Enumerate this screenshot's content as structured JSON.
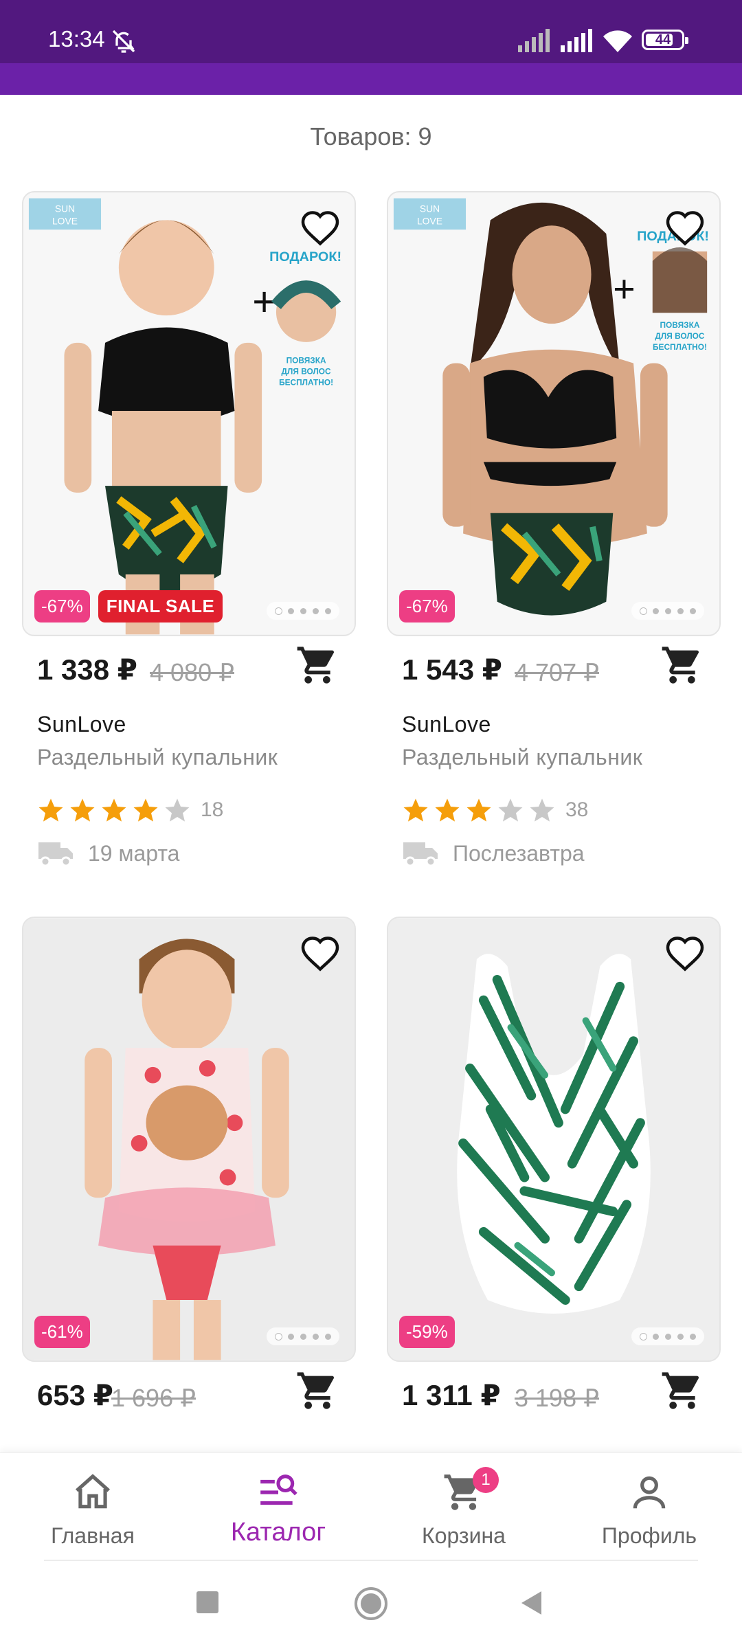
{
  "status_bar": {
    "time": "13:34",
    "battery": "44"
  },
  "catalog": {
    "count_label": "Товаров: 9"
  },
  "products": [
    {
      "price": "1 338 ₽",
      "old_price": "4 080 ₽",
      "brand": "SunLove",
      "type": "Раздельный купальник",
      "discount": "-67%",
      "sale_badge": "FINAL SALE",
      "rating": 4,
      "reviews": "18",
      "delivery": "19 марта"
    },
    {
      "price": "1 543 ₽",
      "old_price": "4 707 ₽",
      "brand": "SunLove",
      "type": "Раздельный купальник",
      "discount": "-67%",
      "rating": 3,
      "reviews": "38",
      "delivery": "Послезавтра"
    },
    {
      "price": "653 ₽",
      "old_price": "1 696 ₽",
      "discount": "-61%"
    },
    {
      "price": "1 311 ₽",
      "old_price": "3 198 ₽",
      "discount": "-59%"
    }
  ],
  "image_text": {
    "brand_logo": "SUN LOVE",
    "gift": "ПОДАРОК!",
    "gift_note": "ПОВЯЗКА ДЛЯ ВОЛОС БЕСПЛАТНО!"
  },
  "bottom_nav": {
    "items": [
      {
        "label": "Главная",
        "icon": "home-icon"
      },
      {
        "label": "Каталог",
        "icon": "catalog-search-icon",
        "active": true
      },
      {
        "label": "Корзина",
        "icon": "cart-icon",
        "badge": "1"
      },
      {
        "label": "Профиль",
        "icon": "profile-icon"
      }
    ]
  },
  "colors": {
    "status_bar": "#52187f",
    "accent": "#9c27b0",
    "discount": "#ed3e84",
    "sale": "#e0202e",
    "star": "#f59e0b"
  }
}
